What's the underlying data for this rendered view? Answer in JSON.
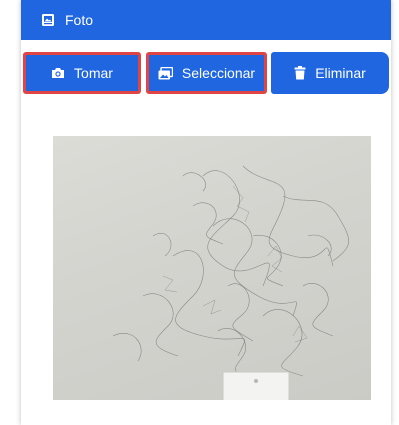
{
  "header": {
    "title": "Foto",
    "icon": "image-gallery-icon"
  },
  "buttons": {
    "take": {
      "label": "Tomar",
      "icon": "camera-icon"
    },
    "select": {
      "label": "Seleccionar",
      "icon": "images-icon"
    },
    "delete": {
      "label": "Eliminar",
      "icon": "trash-icon"
    }
  },
  "colors": {
    "primary": "#1f66e0",
    "highlight_border": "#e04545"
  }
}
